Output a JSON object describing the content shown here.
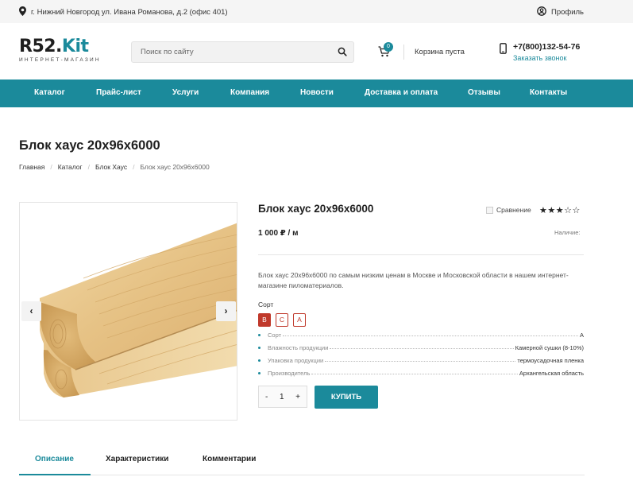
{
  "topbar": {
    "address": "г. Нижний Новгород ул. Ивана Романова, д.2 (офис 401)",
    "profile": "Профиль"
  },
  "logo": {
    "main": "R52.",
    "accent": "Kit",
    "sub": "ИНТЕРНЕТ-МАГАЗИН"
  },
  "search": {
    "placeholder": "Поиск по сайту"
  },
  "cart": {
    "count": "0",
    "text": "Корзина пуста"
  },
  "contact": {
    "phone": "+7(800)132-54-76",
    "callback": "Заказать звонок"
  },
  "nav": {
    "items": [
      {
        "label": "Каталог"
      },
      {
        "label": "Прайс-лист"
      },
      {
        "label": "Услуги"
      },
      {
        "label": "Компания"
      },
      {
        "label": "Новости"
      },
      {
        "label": "Доставка и оплата"
      },
      {
        "label": "Отзывы"
      },
      {
        "label": "Контакты"
      }
    ]
  },
  "page": {
    "title": "Блок хаус 20х96х6000"
  },
  "breadcrumb": [
    "Главная",
    "Каталог",
    "Блок Хаус",
    "Блок хаус 20х96х6000"
  ],
  "product": {
    "title": "Блок хаус 20х96х6000",
    "compare": "Сравнение",
    "rating": 3,
    "rating_max": 5,
    "price": "1 000 ₽ / м",
    "availability": "Наличие:",
    "description": "Блок хаус 20х96х6000 по самым низким ценам в Москве и Московской области в нашем интернет-магазине пиломатериалов.",
    "sort_label": "Сорт",
    "sort_options": [
      "В",
      "С",
      "А"
    ],
    "sort_selected": "В",
    "properties": [
      {
        "key": "Сорт",
        "value": "А"
      },
      {
        "key": "Влажность продукции",
        "value": "Камерной сушки (8-10%)"
      },
      {
        "key": "Упаковка продукции",
        "value": "термоусадочная пленка"
      },
      {
        "key": "Производитель",
        "value": "Архангельская область"
      }
    ],
    "quantity": "1",
    "minus": "-",
    "plus": "+",
    "buy": "КУПИТЬ"
  },
  "tabs": {
    "items": [
      {
        "label": "Описание"
      },
      {
        "label": "Характеристики"
      },
      {
        "label": "Комментарии"
      }
    ],
    "active": "Описание"
  },
  "colors": {
    "accent": "#1b8a9b",
    "sort_active": "#c0392b"
  }
}
